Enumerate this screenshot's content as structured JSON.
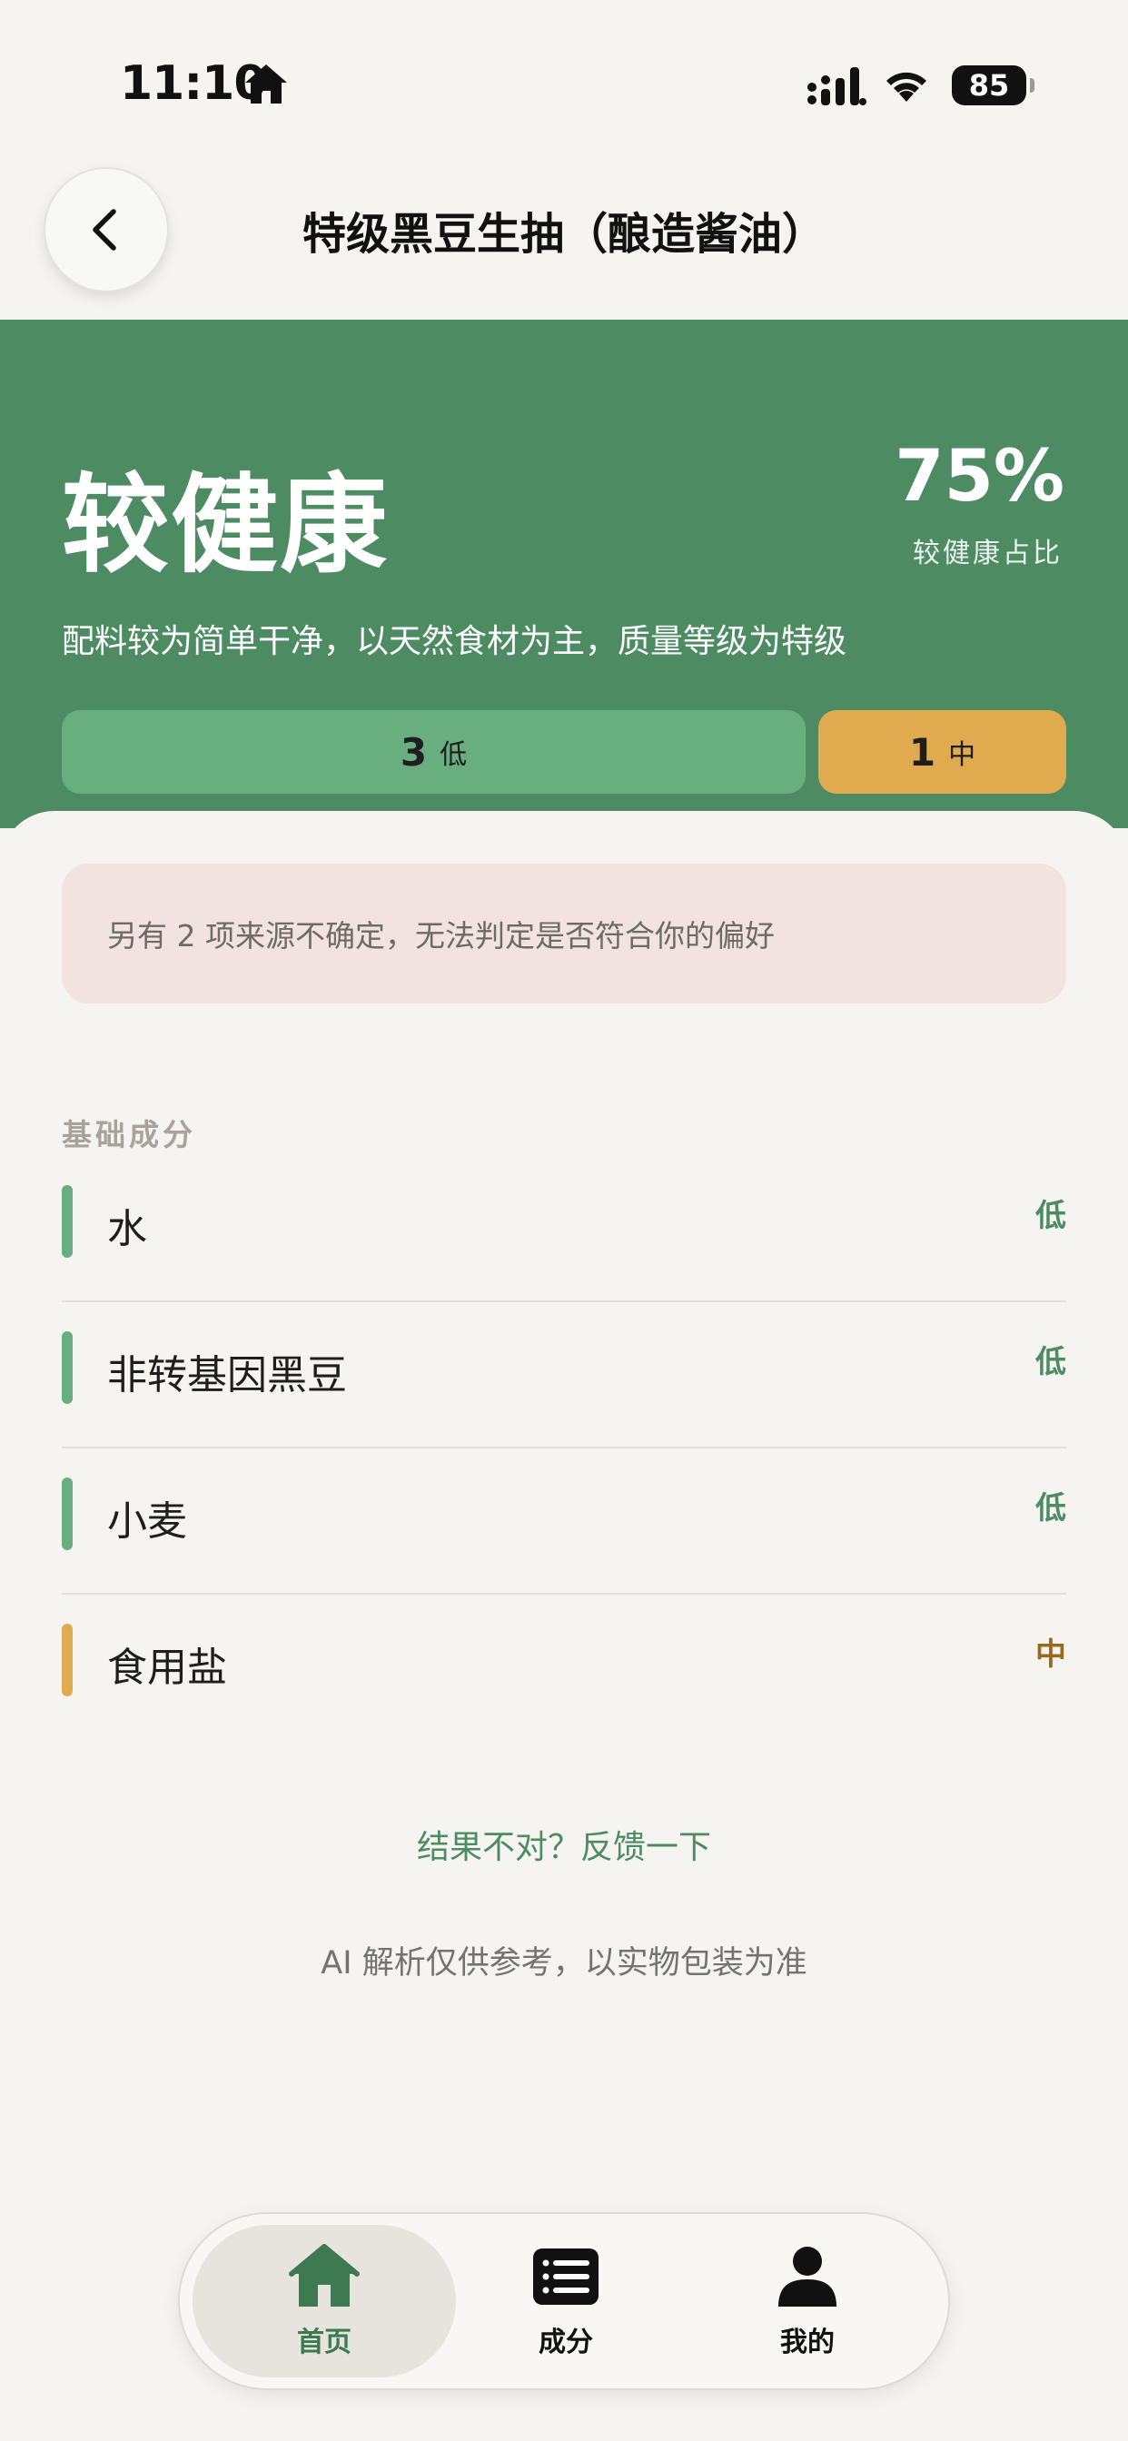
{
  "status_bar": {
    "time": "11:10",
    "battery": "85"
  },
  "header": {
    "title": "特级黑豆生抽（酿造酱油）"
  },
  "hero": {
    "verdict": "较健康",
    "percent": "75%",
    "percent_label": "较健康占比",
    "description": "配料较为简单干净，以天然食材为主，质量等级为特级",
    "levels": [
      {
        "count": "3",
        "label": "低",
        "color": "#68ae7f",
        "share": 0.75
      },
      {
        "count": "1",
        "label": "中",
        "color": "#e0aa4f",
        "share": 0.25
      }
    ]
  },
  "notice": "另有 2 项来源不确定，无法判定是否符合你的偏好",
  "section_title": "基础成分",
  "ingredients": [
    {
      "name": "水",
      "level": "低"
    },
    {
      "name": "非转基因黑豆",
      "level": "低"
    },
    {
      "name": "小麦",
      "level": "低"
    },
    {
      "name": "食用盐",
      "level": "中"
    }
  ],
  "feedback_link": "结果不对？反馈一下",
  "disclaimer": "AI 解析仅供参考，以实物包装为准",
  "tabs": [
    {
      "label": "首页",
      "icon": "home-icon",
      "active": true
    },
    {
      "label": "成分",
      "icon": "list-icon",
      "active": false
    },
    {
      "label": "我的",
      "icon": "person-icon",
      "active": false
    }
  ],
  "colors": {
    "brand_green": "#4d8c63",
    "low": "#68ae7f",
    "mid": "#e0aa4f",
    "background": "#f6f4f0"
  }
}
